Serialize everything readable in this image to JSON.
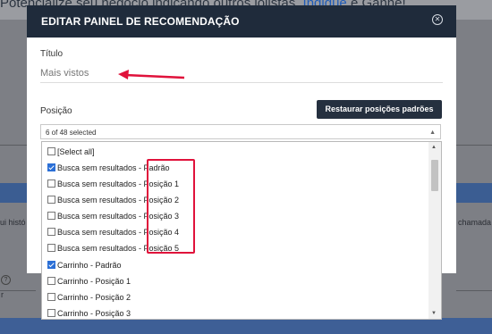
{
  "background": {
    "banner_text": "Potencialize seu negócio indicando outros lojistas.",
    "banner_link": "Indique",
    "banner_tail": "e Ganhe!",
    "left_text": "ui histó",
    "right_text": "chamada",
    "bottom_left": "r"
  },
  "modal": {
    "title": "EDITAR PAINEL DE RECOMENDAÇÃO",
    "close_icon": "close-circle-icon",
    "titulo_label": "Título",
    "titulo_value": "Mais vistos",
    "posicao_label": "Posição",
    "restore_label": "Restaurar posições padrões",
    "select_summary": "6 of 48 selected",
    "options": [
      {
        "label": "[Select all]",
        "checked": false
      },
      {
        "label": "Busca sem resultados - Padrão",
        "checked": true
      },
      {
        "label": "Busca sem resultados - Posição 1",
        "checked": false
      },
      {
        "label": "Busca sem resultados - Posição 2",
        "checked": false
      },
      {
        "label": "Busca sem resultados - Posição 3",
        "checked": false
      },
      {
        "label": "Busca sem resultados - Posição 4",
        "checked": false
      },
      {
        "label": "Busca sem resultados - Posição 5",
        "checked": false
      },
      {
        "label": "Carrinho - Padrão",
        "checked": true
      },
      {
        "label": "Carrinho - Posição 1",
        "checked": false
      },
      {
        "label": "Carrinho - Posição 2",
        "checked": false
      },
      {
        "label": "Carrinho - Posição 3",
        "checked": false
      }
    ]
  },
  "colors": {
    "header": "#1f2b3b",
    "annotation": "#e0123b",
    "checkbox_checked": "#2b6fd6"
  }
}
